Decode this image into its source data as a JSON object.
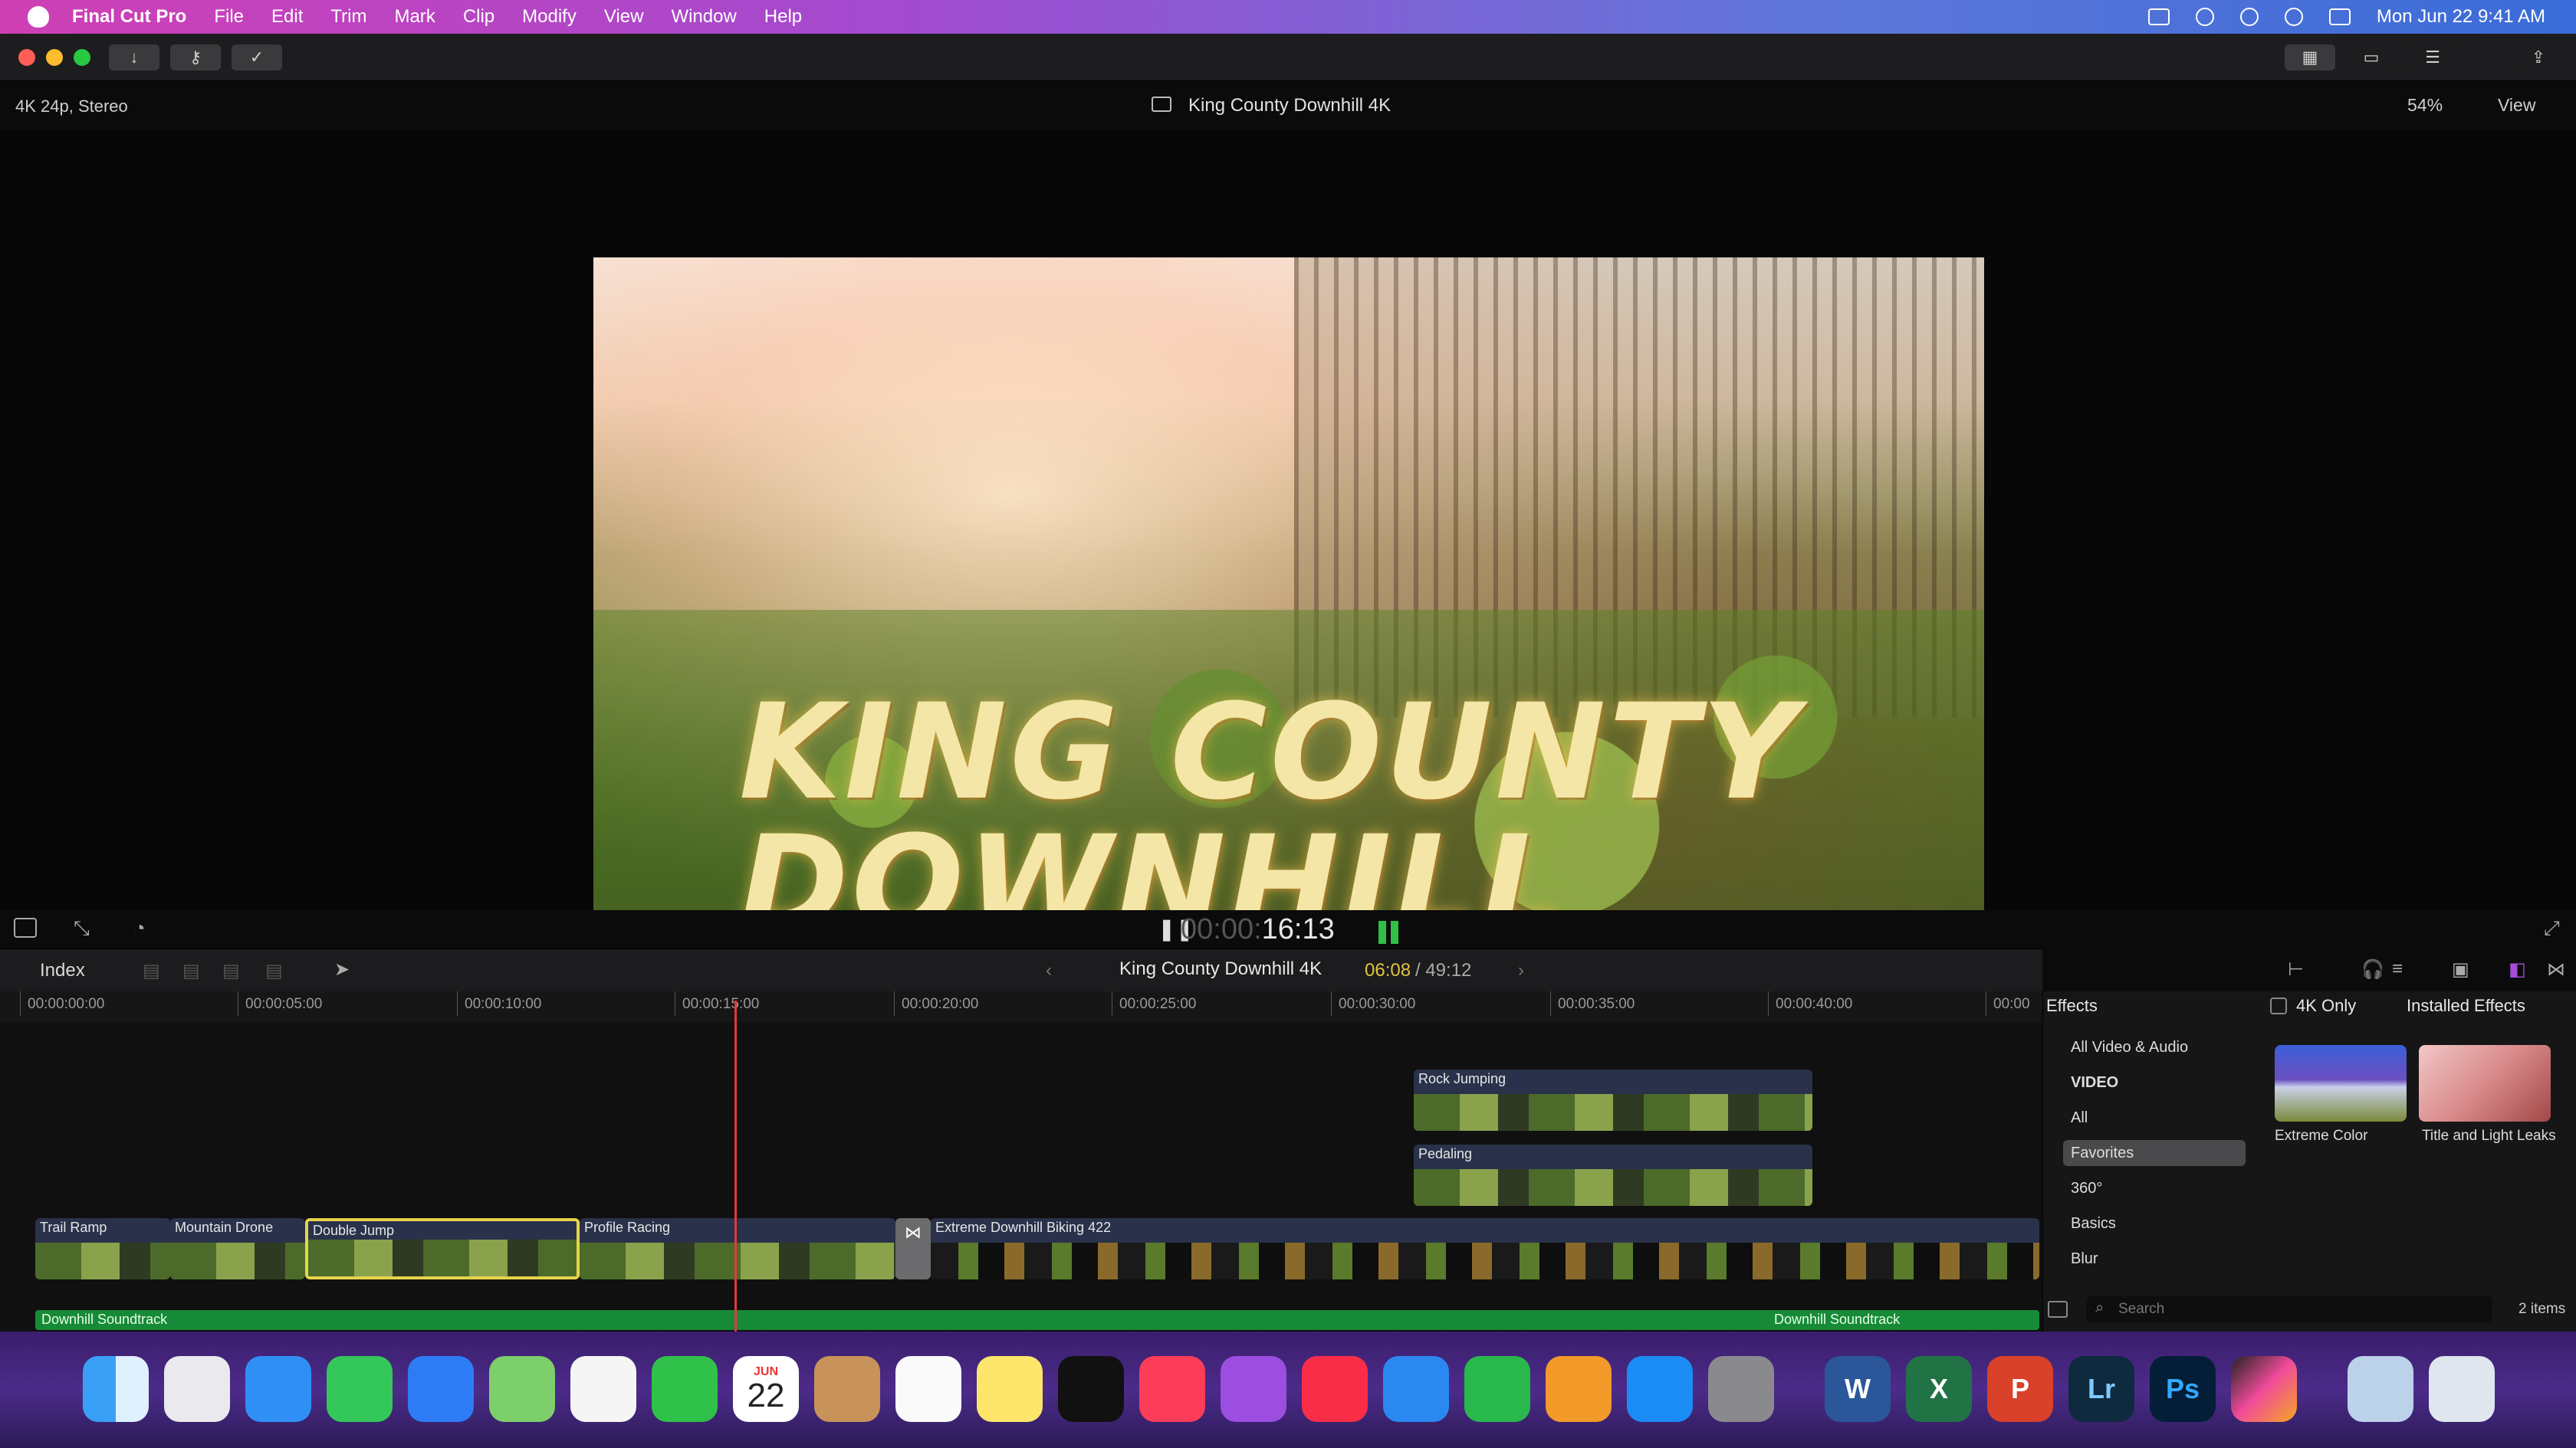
{
  "menubar": {
    "app": "Final Cut Pro",
    "items": [
      "File",
      "Edit",
      "Trim",
      "Mark",
      "Clip",
      "Modify",
      "View",
      "Window",
      "Help"
    ],
    "datetime": "Mon Jun 22  9:41 AM"
  },
  "viewer": {
    "format": "4K 24p, Stereo",
    "project_title": "King County Downhill 4K",
    "zoom": "54%",
    "view_menu": "View",
    "video_title": "KING COUNTY\nDOWNHILL",
    "timecode_dim": "00:00:",
    "timecode_main": "16:13"
  },
  "timeline": {
    "index_label": "Index",
    "project_name": "King County Downhill 4K",
    "position": "06:08",
    "duration": "/ 49:12",
    "ruler": [
      "00:00:00:00",
      "00:00:05:00",
      "00:00:10:00",
      "00:00:15:00",
      "00:00:20:00",
      "00:00:25:00",
      "00:00:30:00",
      "00:00:35:00",
      "00:00:40:00",
      "00:00"
    ],
    "connected_clips": [
      "Rock Jumping",
      "Pedaling"
    ],
    "primary_clips": [
      "Trail Ramp",
      "Mountain Drone",
      "Double Jump",
      "Profile Racing",
      "Extreme Downhill Biking 422"
    ],
    "audio_clips": [
      "Downhill Soundtrack",
      "Downhill Soundtrack"
    ]
  },
  "effects": {
    "title": "Effects",
    "filter_4k": "4K Only",
    "installed": "Installed Effects",
    "categories": [
      "All Video & Audio",
      "VIDEO",
      "All",
      "Favorites",
      "360°",
      "Basics",
      "Blur"
    ],
    "thumbs": [
      "Extreme Color",
      "Title and Light Leaks"
    ],
    "search_placeholder": "Search",
    "item_count": "2 items"
  },
  "dock": {
    "calendar_month": "JUN",
    "calendar_day": "22",
    "labels": [
      "W",
      "X",
      "P",
      "Lr",
      "Ps"
    ]
  },
  "colors": {
    "menubar_gradient_start": "#cf3fb4",
    "selection_yellow": "#e7d34a",
    "playhead": "#e23a3a",
    "audio_green": "#178a37",
    "clip_blue": "#29324a"
  }
}
